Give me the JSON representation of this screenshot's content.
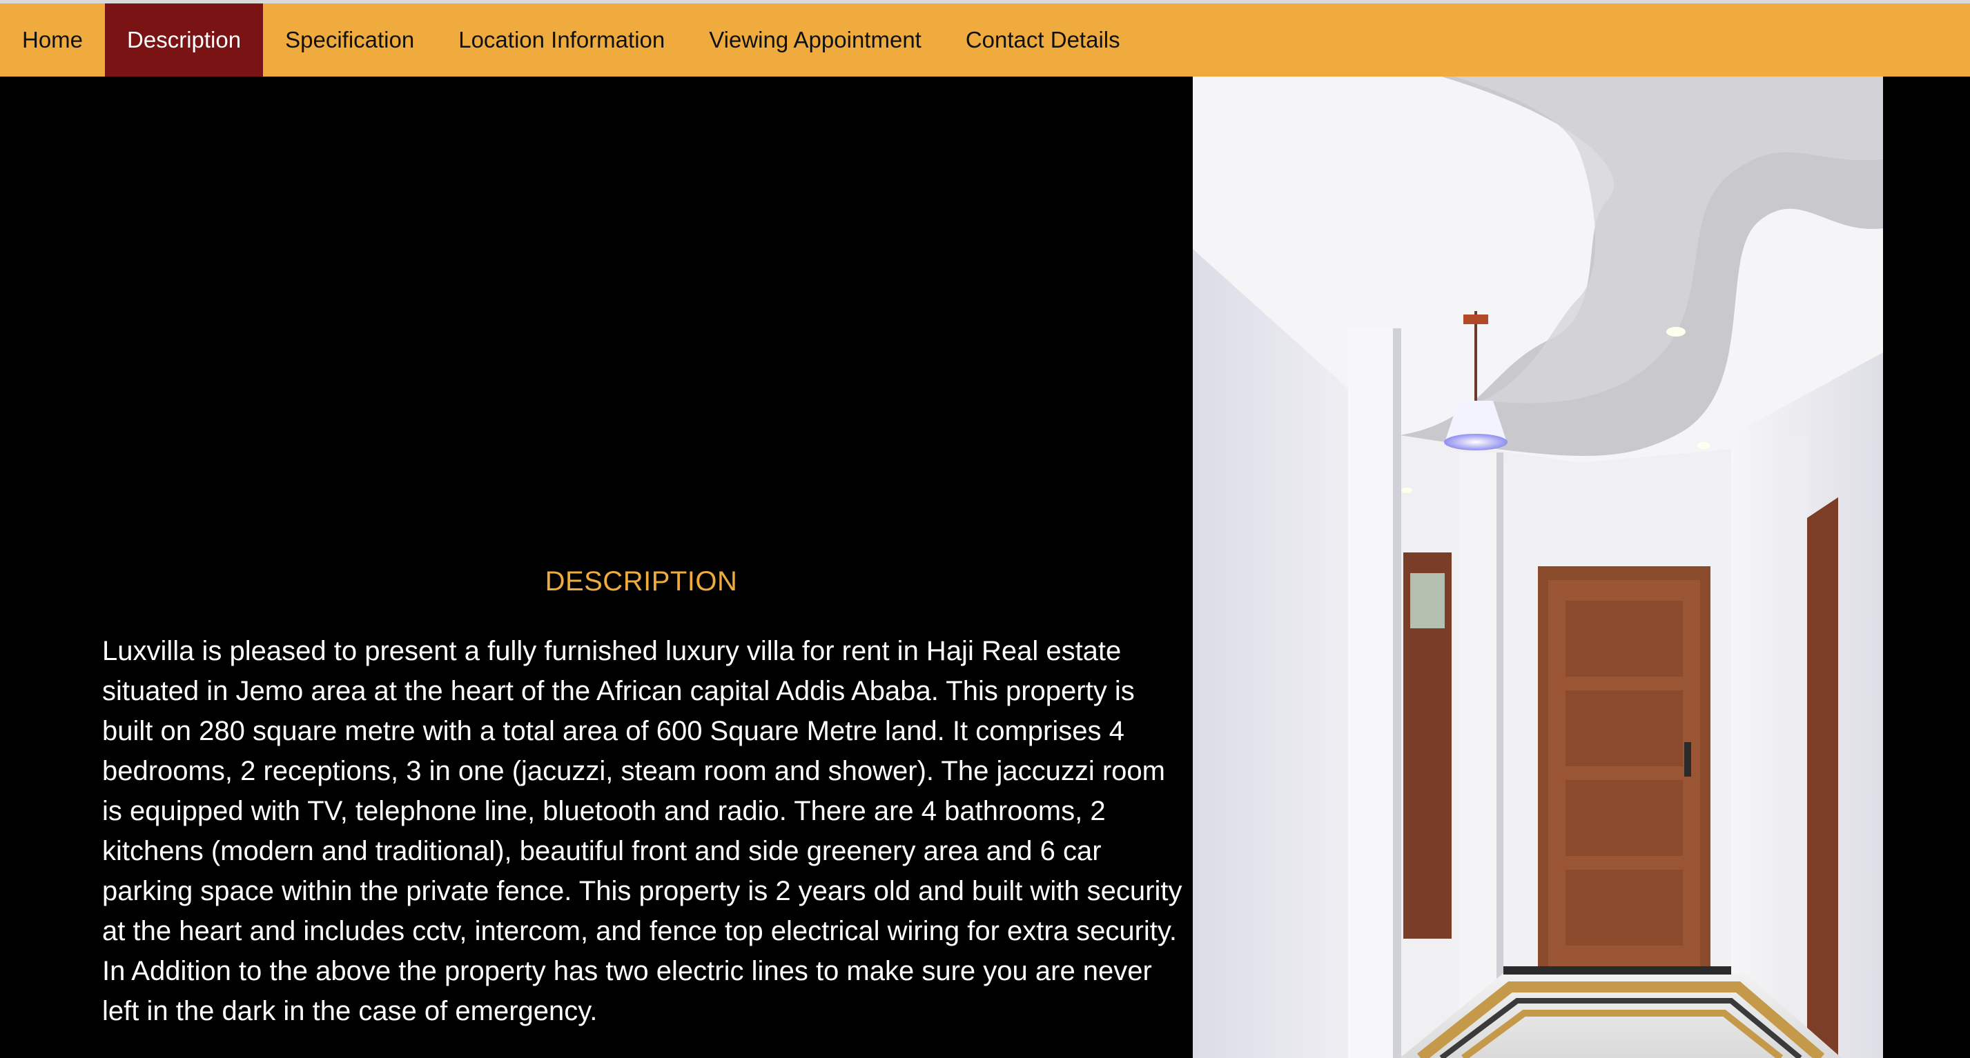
{
  "nav": {
    "items": [
      {
        "label": "Home",
        "active": false
      },
      {
        "label": "Description",
        "active": true
      },
      {
        "label": "Specification",
        "active": false
      },
      {
        "label": "Location Information",
        "active": false
      },
      {
        "label": "Viewing Appointment",
        "active": false
      },
      {
        "label": "Contact Details",
        "active": false
      }
    ]
  },
  "description": {
    "title": "DESCRIPTION",
    "body": "Luxvilla is pleased to present a fully furnished luxury villa for rent in Haji Real estate situated in Jemo area at the heart of the African capital Addis Ababa. This property is built on 280 square metre with a total area of 600 Square Metre land. It comprises 4 bedrooms, 2 receptions, 3 in one (jacuzzi, steam room and shower). The jaccuzzi room is equipped with TV, telephone line, bluetooth and radio. There are 4 bathrooms, 2 kitchens (modern and traditional), beautiful front and side greenery area and 6 car parking space within the private fence. This property is 2 years old and built with security at the heart and includes cctv, intercom, and fence top electrical wiring for extra security. In Addition to the above the property has two electric lines to make sure you are never left in the dark in the case of emergency."
  },
  "colors": {
    "nav_background": "#f0ab3f",
    "nav_active": "#7a1313",
    "title_accent": "#f0ab3f",
    "page_background": "#000000"
  }
}
